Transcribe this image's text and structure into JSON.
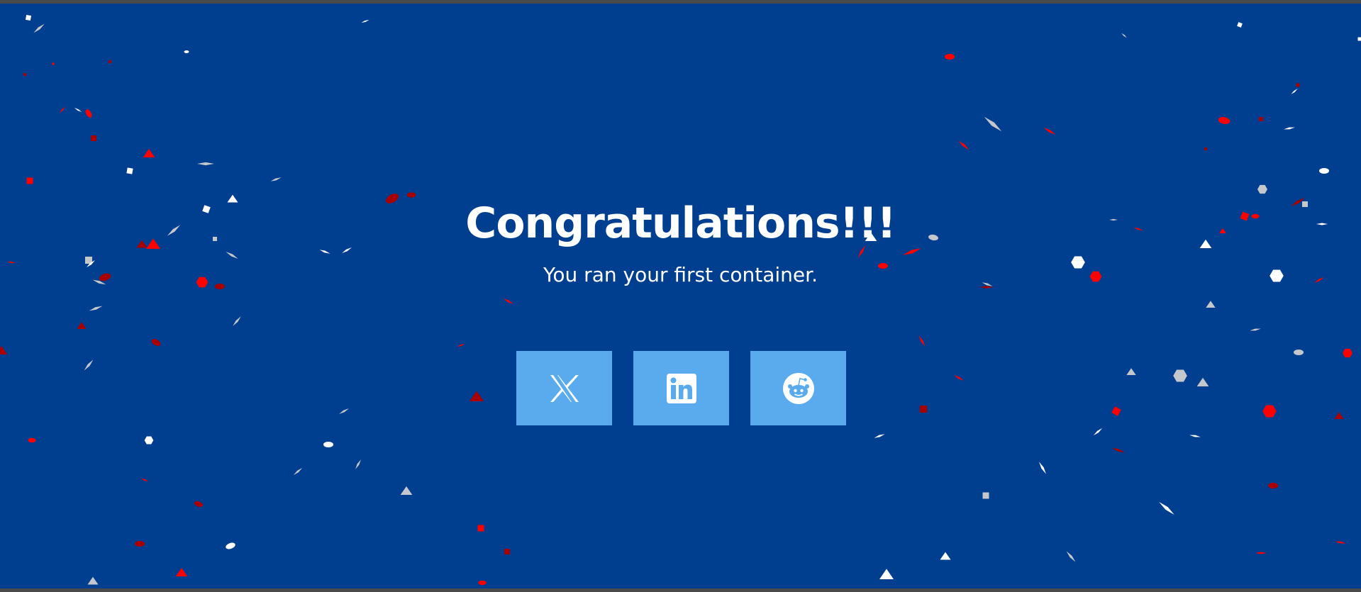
{
  "page": {
    "headline": "Congratulations!!!",
    "subheading": "You ran your first container."
  },
  "share_buttons": [
    {
      "network": "X",
      "icon": "x-logo-icon"
    },
    {
      "network": "LinkedIn",
      "icon": "linkedin-logo-icon"
    },
    {
      "network": "Reddit",
      "icon": "reddit-logo-icon"
    }
  ],
  "colors": {
    "background": "#003f8f",
    "text": "#ffffff",
    "button": "#5aabee",
    "confetti": [
      "#ff0000",
      "#a80000",
      "#ffffff",
      "#c4c7cc"
    ]
  }
}
